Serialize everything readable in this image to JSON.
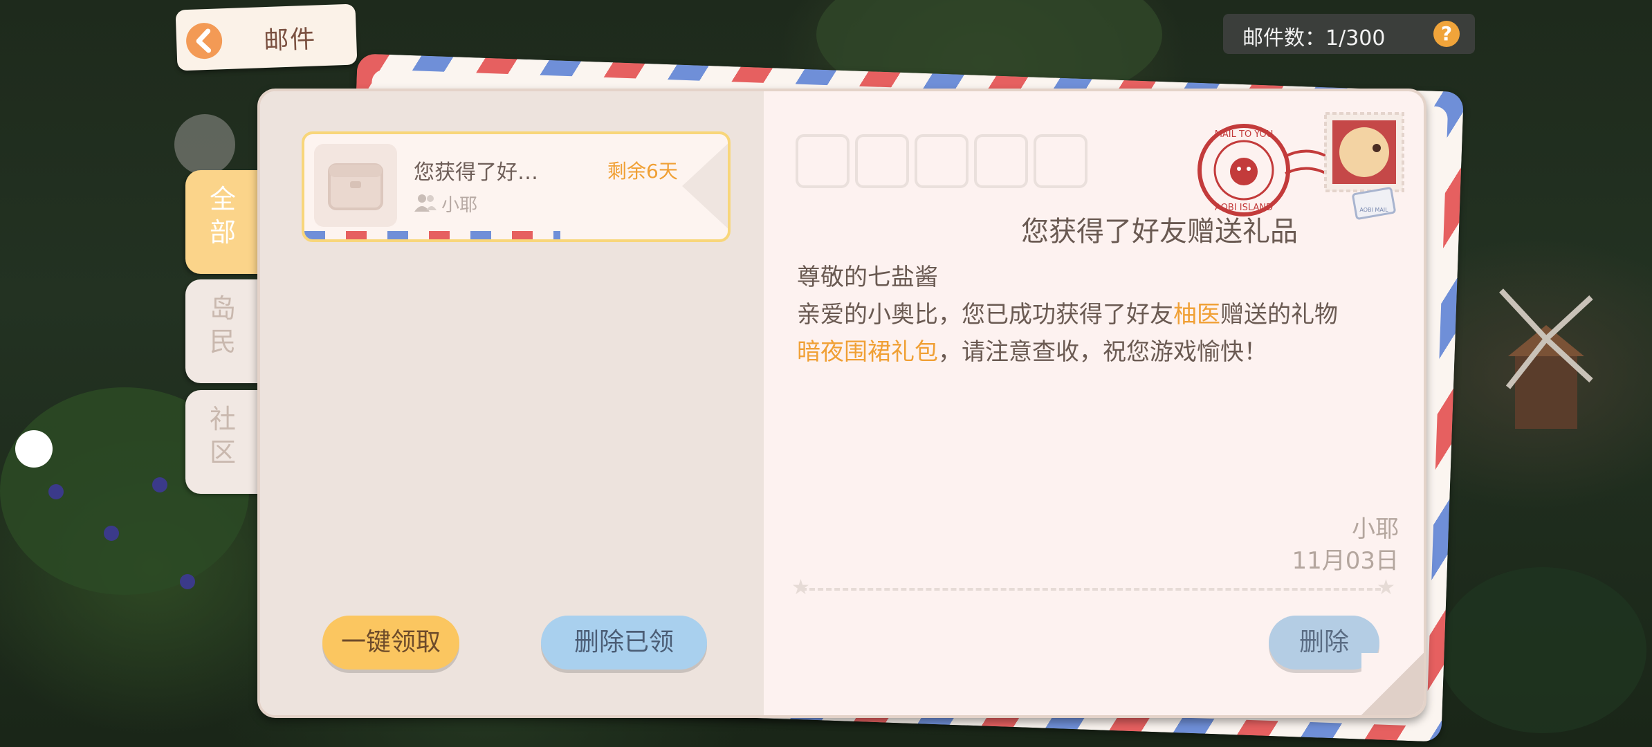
{
  "header": {
    "back_title": "邮件",
    "mail_count": "邮件数：1/300",
    "help_label": "?"
  },
  "tabs": [
    {
      "label": "全\n部",
      "active": true
    },
    {
      "label": "岛\n民",
      "active": false
    },
    {
      "label": "社\n区",
      "active": false
    }
  ],
  "mail_list": [
    {
      "title": "您获得了好…",
      "remaining": "剩余6天",
      "sender": "小耶"
    }
  ],
  "buttons": {
    "claim_all": "一键领取",
    "delete_read": "删除已领",
    "delete": "删除"
  },
  "letter": {
    "title": "您获得了好友赠送礼品",
    "greeting": "尊敬的七盐酱",
    "line1_prefix": "亲爱的小奥比，您已成功获得了好友",
    "friend_name": "柚医",
    "line1_suffix": "赠送的礼物",
    "gift_name": "暗夜围裙礼包",
    "line2_suffix": "，请注意查收，祝您游戏愉快！",
    "signature": "小耶",
    "date": "11月03日"
  },
  "postmark": {
    "text_top": "MAIL TO YOU",
    "text_bottom": "AOBI ISLAND",
    "air_mail": "AOBI MAIL"
  },
  "colors": {
    "accent_orange": "#f0a035",
    "tab_active": "#fbd48a",
    "claim_button": "#fbc660",
    "delete_button": "#a9d0ee"
  }
}
